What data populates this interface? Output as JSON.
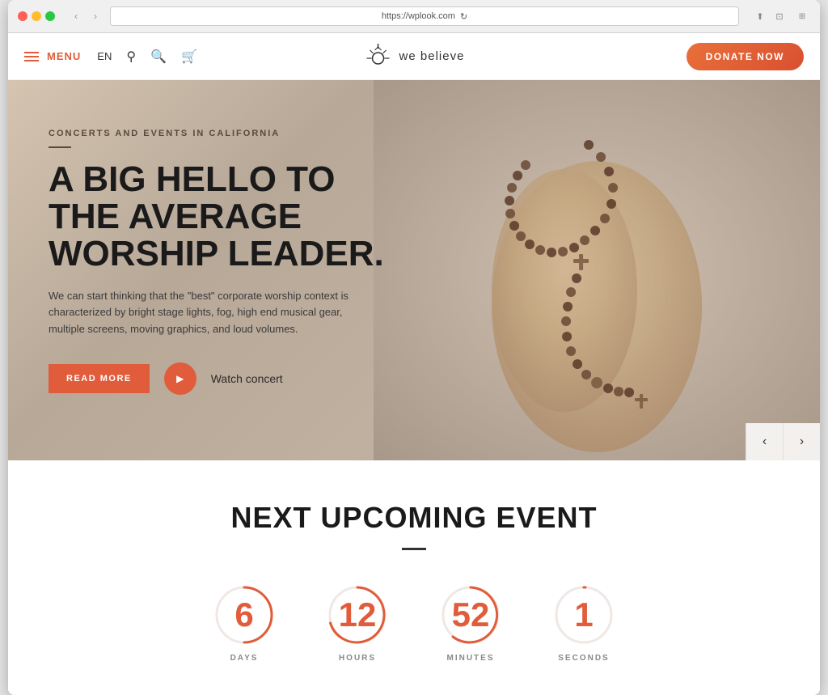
{
  "browser": {
    "url": "https://wplook.com",
    "refresh_icon": "↻"
  },
  "navbar": {
    "menu_label": "MENU",
    "lang_label": "EN",
    "logo_text": "we believe",
    "donate_label": "DONATE NOW"
  },
  "hero": {
    "subtitle": "CONCERTS AND EVENTS IN CALIFORNIA",
    "title_line1": "A BIG HELLO TO",
    "title_line2": "THE AVERAGE",
    "title_line3": "WORSHIP LEADER.",
    "description": "We can start thinking that the \"best\" corporate worship context is characterized by bright stage lights, fog, high end musical gear, multiple screens, moving graphics, and loud volumes.",
    "read_more_label": "READ MORE",
    "watch_label": "Watch concert"
  },
  "upcoming": {
    "section_title": "NEXT UPCOMING EVENT",
    "countdown": [
      {
        "value": "6",
        "label": "DAYS"
      },
      {
        "value": "12",
        "label": "HOURS"
      },
      {
        "value": "52",
        "label": "MINUTES"
      },
      {
        "value": "1",
        "label": "SECONDS"
      }
    ]
  },
  "colors": {
    "accent": "#e05c3a",
    "dark": "#1a1a1a",
    "muted": "#888888"
  }
}
